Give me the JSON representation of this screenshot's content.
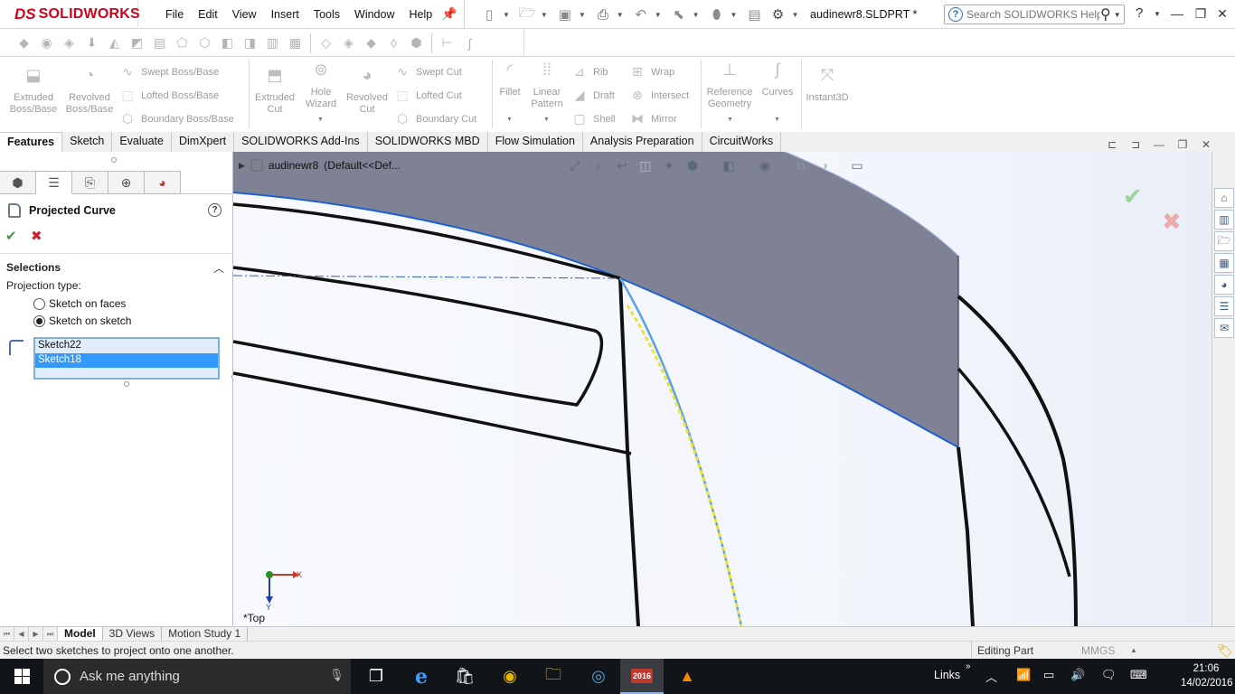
{
  "app": {
    "brand_ds": "DS",
    "brand_name": "SOLIDWORKS",
    "doc_title": "audinewr8.SLDPRT *",
    "help_search_placeholder": "Search SOLIDWORKS Help"
  },
  "menu": [
    "File",
    "Edit",
    "View",
    "Insert",
    "Tools",
    "Window",
    "Help"
  ],
  "command_manager": {
    "extruded_boss": "Extruded\nBoss/Base",
    "revolved_boss": "Revolved\nBoss/Base",
    "swept_boss": "Swept Boss/Base",
    "lofted_boss": "Lofted Boss/Base",
    "boundary_boss": "Boundary Boss/Base",
    "extruded_cut": "Extruded\nCut",
    "hole_wizard": "Hole\nWizard",
    "revolved_cut": "Revolved\nCut",
    "swept_cut": "Swept Cut",
    "lofted_cut": "Lofted Cut",
    "boundary_cut": "Boundary Cut",
    "fillet": "Fillet",
    "linear_pattern": "Linear\nPattern",
    "rib": "Rib",
    "draft": "Draft",
    "shell": "Shell",
    "wrap": "Wrap",
    "intersect": "Intersect",
    "mirror": "Mirror",
    "reference_geometry": "Reference\nGeometry",
    "curves": "Curves",
    "instant3d": "Instant3D"
  },
  "tabs": [
    {
      "label": "Features",
      "active": true
    },
    {
      "label": "Sketch",
      "active": false
    },
    {
      "label": "Evaluate",
      "active": false
    },
    {
      "label": "DimXpert",
      "active": false
    },
    {
      "label": "SOLIDWORKS Add-Ins",
      "active": false
    },
    {
      "label": "SOLIDWORKS MBD",
      "active": false
    },
    {
      "label": "Flow Simulation",
      "active": false
    },
    {
      "label": "Analysis Preparation",
      "active": false
    },
    {
      "label": "CircuitWorks",
      "active": false
    }
  ],
  "property_manager": {
    "title": "Projected Curve",
    "help": "?",
    "ok": "✔",
    "cancel": "✖",
    "selections_header": "Selections",
    "projection_type_label": "Projection type:",
    "option_faces": "Sketch on faces",
    "option_sketch": "Sketch on sketch",
    "selected_option": "sketch",
    "selection_list": [
      "Sketch22",
      "Sketch18"
    ],
    "selected_item": "Sketch18"
  },
  "viewport": {
    "breadcrumb_part": "audinewr8",
    "breadcrumb_config": "(Default<<Def...",
    "view_label": "*Top",
    "triad_x": "X",
    "triad_y": "Y",
    "confirm_ok": "✔",
    "confirm_cancel": "✖",
    "colors": {
      "surface": "#7e8294",
      "edge_highlight": "#1f5fd6",
      "projected_curve": "#e8e23a",
      "sketch_lines": "#111111"
    }
  },
  "bottom_tabs": [
    {
      "label": "Model",
      "active": true
    },
    {
      "label": "3D Views",
      "active": false
    },
    {
      "label": "Motion Study 1",
      "active": false
    }
  ],
  "status": {
    "message": "Select two sketches to project onto one another.",
    "mode": "Editing Part",
    "units": "MMGS"
  },
  "taskbar": {
    "search_placeholder": "Ask me anything",
    "tray_links": "Links",
    "time": "21:06",
    "date": "14/02/2016",
    "solidworks_badge": "2016"
  }
}
